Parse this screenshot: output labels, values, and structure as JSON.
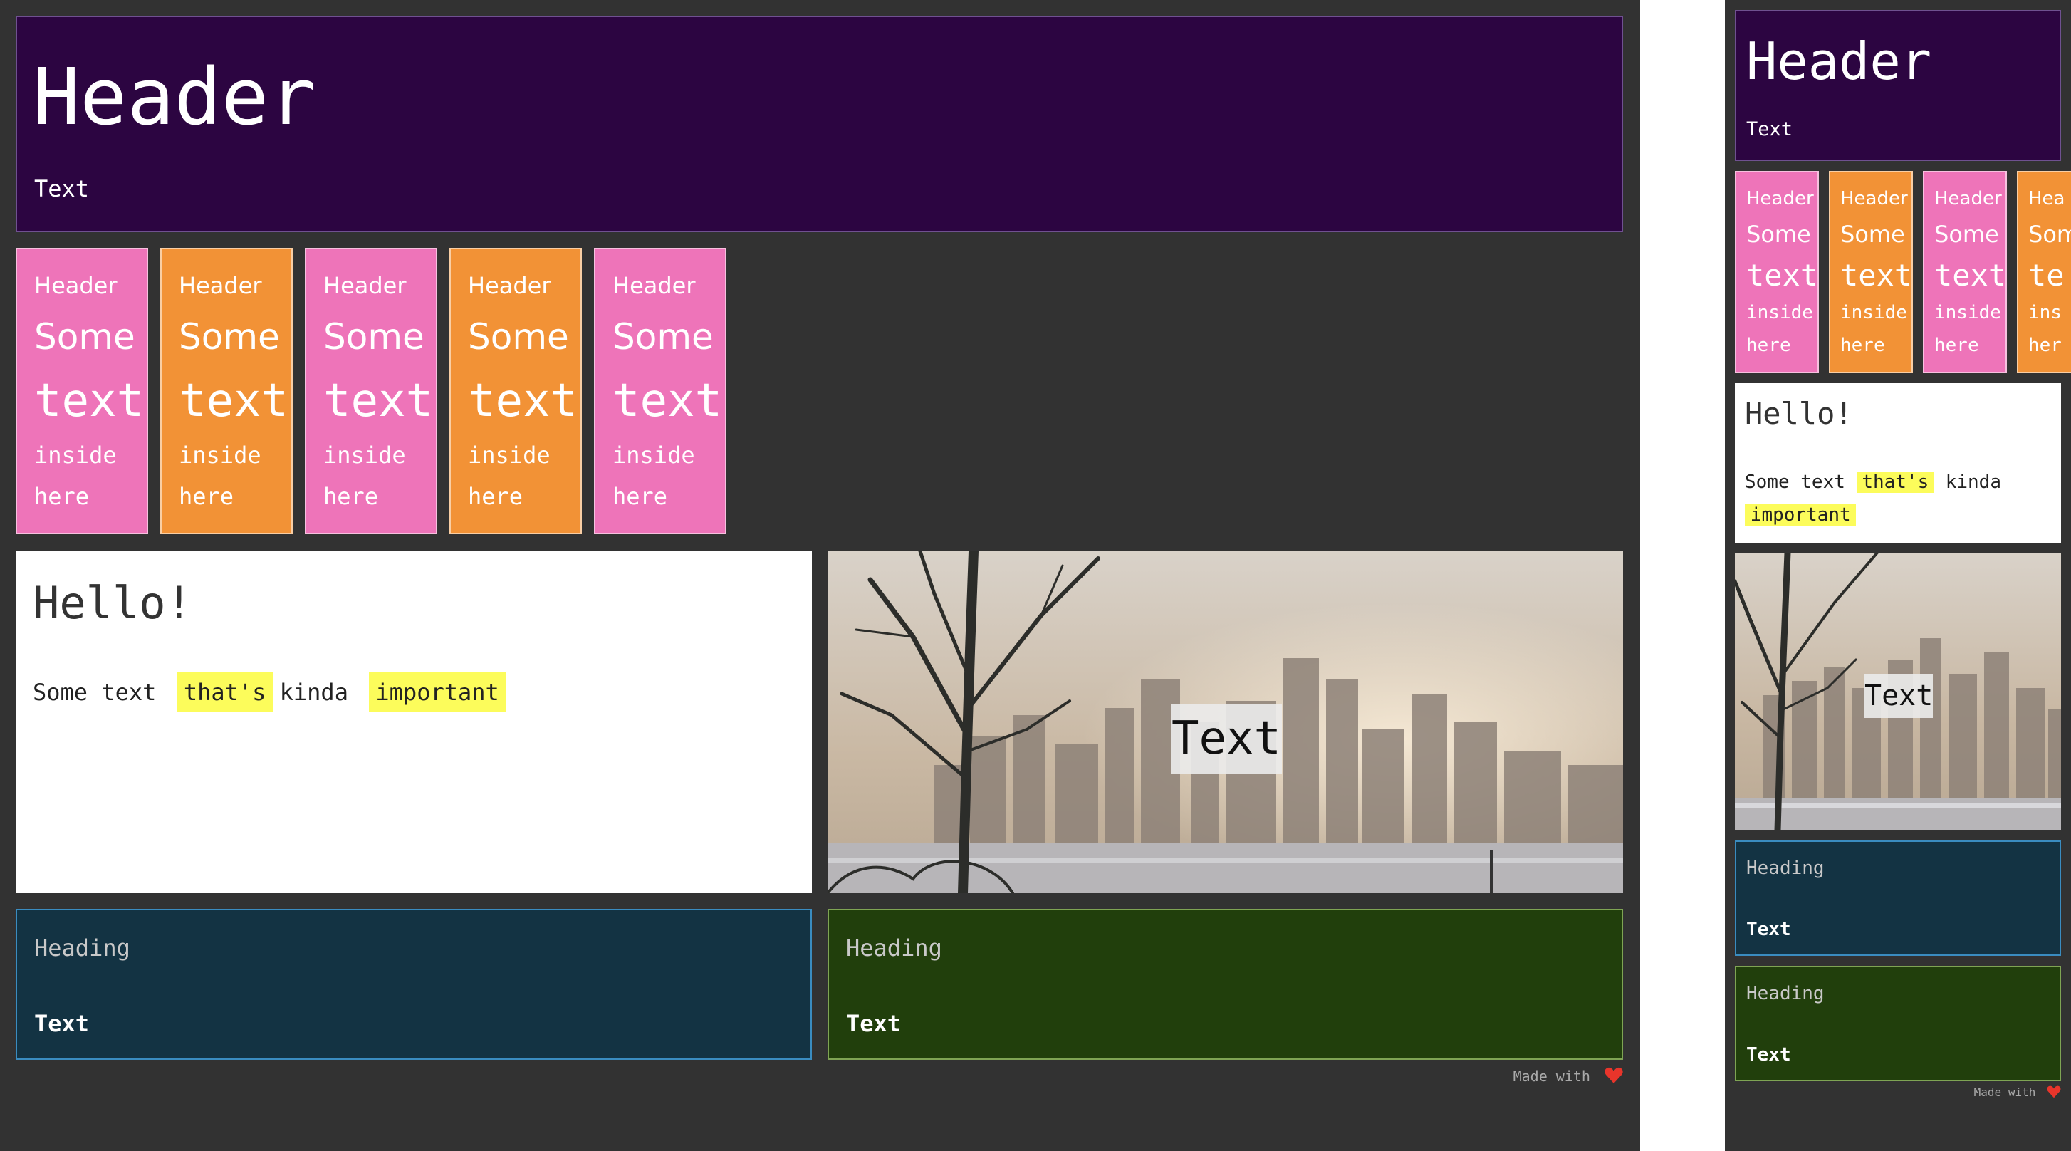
{
  "header": {
    "title": "Header",
    "text": "Text"
  },
  "tiles": [
    {
      "header": "Header",
      "some": "Some",
      "text": "text",
      "inside": "inside",
      "here": "here",
      "color": "#ee74b9"
    },
    {
      "header": "Header",
      "some": "Some",
      "text": "text",
      "inside": "inside",
      "here": "here",
      "color": "#f29236"
    },
    {
      "header": "Header",
      "some": "Some",
      "text": "text",
      "inside": "inside",
      "here": "here",
      "color": "#ee74b9"
    },
    {
      "header": "Header",
      "some": "Some",
      "text": "text",
      "inside": "inside",
      "here": "here",
      "color": "#f29236"
    },
    {
      "header": "Header",
      "some": "Some",
      "text": "text",
      "inside": "inside",
      "here": "here",
      "color": "#ee74b9"
    }
  ],
  "narrow_tiles": [
    {
      "header": "Header",
      "some": "Some",
      "text": "text",
      "inside": "inside",
      "here": "here",
      "color": "#ee74b9"
    },
    {
      "header": "Header",
      "some": "Some",
      "text": "text",
      "inside": "inside",
      "here": "here",
      "color": "#f29236"
    },
    {
      "header": "Header",
      "some": "Some",
      "text": "text",
      "inside": "inside",
      "here": "here",
      "color": "#ee74b9"
    },
    {
      "header": "Hea",
      "some": "Som",
      "text": "te",
      "inside": "ins",
      "here": "her",
      "color": "#f29236"
    }
  ],
  "hello": {
    "title": "Hello!",
    "before": "Some text",
    "highlight1": "that's",
    "middle": "kinda",
    "highlight2": "important",
    "highlight_color": "#fcfc5b"
  },
  "photo": {
    "caption": "Text"
  },
  "cards": [
    {
      "heading": "Heading",
      "text": "Text",
      "color": "#133343"
    },
    {
      "heading": "Heading",
      "text": "Text",
      "color": "#213f0c"
    }
  ],
  "footer": {
    "label": "Made with",
    "icon": "heart-icon",
    "icon_color": "#e8352b"
  },
  "colors": {
    "background": "#323232",
    "header": "#2c0541"
  }
}
